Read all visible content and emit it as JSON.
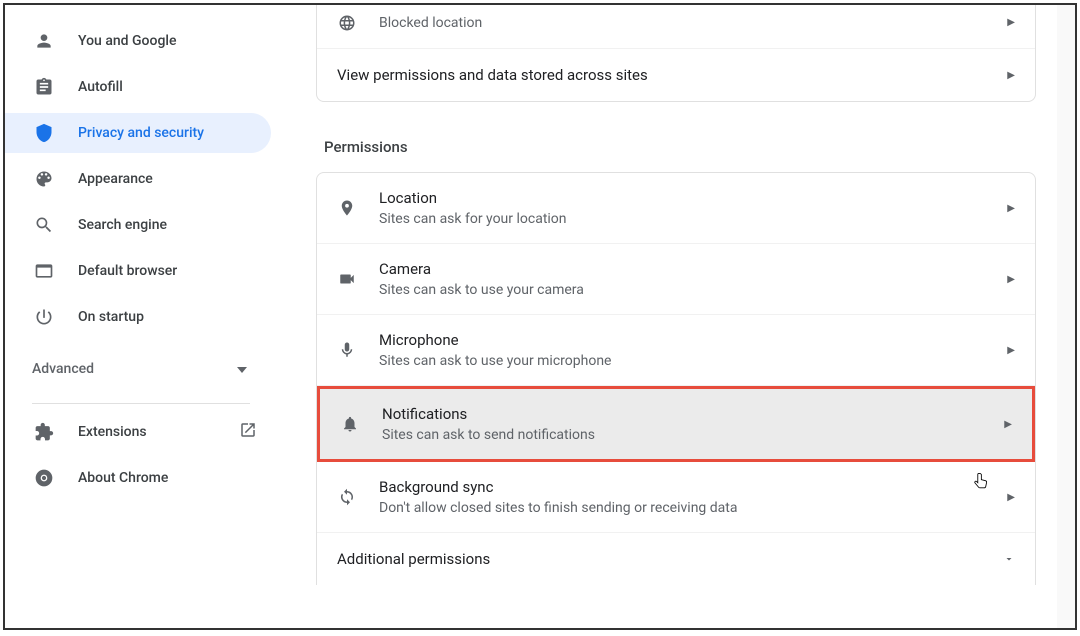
{
  "sidebar": {
    "items": [
      {
        "label": "You and Google"
      },
      {
        "label": "Autofill"
      },
      {
        "label": "Privacy and security"
      },
      {
        "label": "Appearance"
      },
      {
        "label": "Search engine"
      },
      {
        "label": "Default browser"
      },
      {
        "label": "On startup"
      }
    ],
    "advanced": "Advanced",
    "extensions": "Extensions",
    "about": "About Chrome"
  },
  "top_site": {
    "sub": "Blocked location"
  },
  "view_permissions_row": "View permissions and data stored across sites",
  "permissions_header": "Permissions",
  "permissions": [
    {
      "title": "Location",
      "sub": "Sites can ask for your location"
    },
    {
      "title": "Camera",
      "sub": "Sites can ask to use your camera"
    },
    {
      "title": "Microphone",
      "sub": "Sites can ask to use your microphone"
    },
    {
      "title": "Notifications",
      "sub": "Sites can ask to send notifications"
    },
    {
      "title": "Background sync",
      "sub": "Don't allow closed sites to finish sending or receiving data"
    }
  ],
  "additional_permissions": "Additional permissions"
}
